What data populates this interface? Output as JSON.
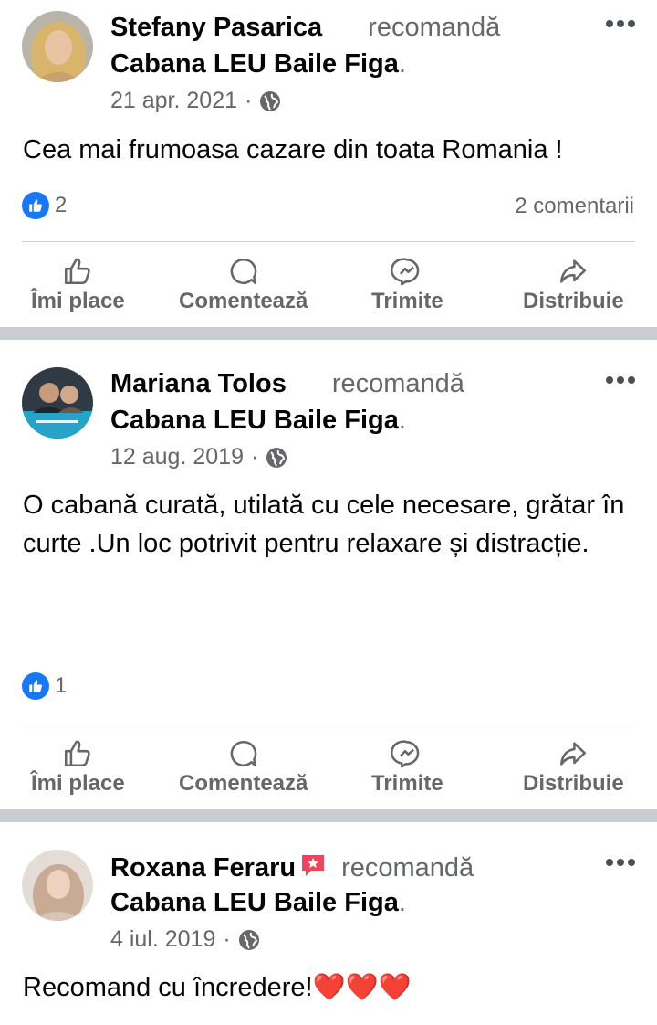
{
  "posts": [
    {
      "author": "Stefany Pasarica",
      "action": "recomandă",
      "page": "Cabana LEU Baile Figa",
      "date": "21 apr. 2021",
      "text": "Cea mai frumoasa cazare din toata Romania !",
      "likes": "2",
      "comments": "2 comentarii",
      "avatar_icon": "avatar-woman-blonde"
    },
    {
      "author": "Mariana Tolos",
      "action": "recomandă",
      "page": "Cabana LEU Baile Figa",
      "date": "12 aug. 2019",
      "text": "O cabană curată, utilată cu cele necesare, grătar în curte .Un loc potrivit pentru relaxare și distracție.",
      "likes": "1",
      "avatar_icon": "avatar-couple"
    },
    {
      "author": "Roxana Feraru",
      "action": "recomandă",
      "page": "Cabana LEU Baile Figa",
      "date": "4 iul. 2019",
      "text": "Recomand cu încredere!",
      "emoji": "❤️❤️❤️",
      "avatar_icon": "avatar-woman-light",
      "badge_icon": "star-message-badge-icon"
    }
  ],
  "actions": {
    "like": "Îmi place",
    "comment": "Comentează",
    "send": "Trimite",
    "share": "Distribuie"
  },
  "colors": {
    "accent": "#1877f2",
    "secondary_text": "#65676b",
    "divider": "#c9ccd1",
    "heart": "#e0245e"
  }
}
